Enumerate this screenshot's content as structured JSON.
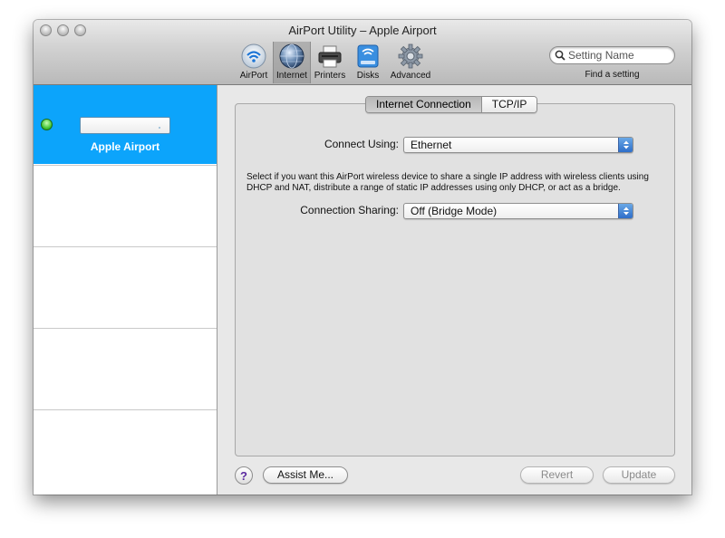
{
  "window": {
    "title": "AirPort Utility – Apple Airport"
  },
  "toolbar": {
    "items": [
      {
        "label": "AirPort",
        "icon": "airport-wifi-icon"
      },
      {
        "label": "Internet",
        "icon": "globe-icon"
      },
      {
        "label": "Printers",
        "icon": "printer-icon"
      },
      {
        "label": "Disks",
        "icon": "disk-icon"
      },
      {
        "label": "Advanced",
        "icon": "gear-icon"
      }
    ],
    "selected": "Internet",
    "search": {
      "placeholder": "Setting Name",
      "caption": "Find a setting"
    }
  },
  "sidebar": {
    "device": {
      "name": "Apple Airport",
      "status_color": "#3ec130"
    }
  },
  "main": {
    "tabs": [
      {
        "label": "Internet Connection",
        "active": true
      },
      {
        "label": "TCP/IP",
        "active": false
      }
    ],
    "connect_using": {
      "label": "Connect Using:",
      "value": "Ethernet"
    },
    "description": "Select if you want this AirPort wireless device to share a single IP address with wireless clients using DHCP and NAT, distribute a range of static IP addresses using only DHCP, or act as a bridge.",
    "connection_sharing": {
      "label": "Connection Sharing:",
      "value": "Off (Bridge Mode)"
    }
  },
  "footer": {
    "help": "?",
    "assist": "Assist Me...",
    "revert": "Revert",
    "update": "Update"
  },
  "colors": {
    "selection": "#0ca4fb",
    "help_glyph": "#5b2aa0"
  }
}
